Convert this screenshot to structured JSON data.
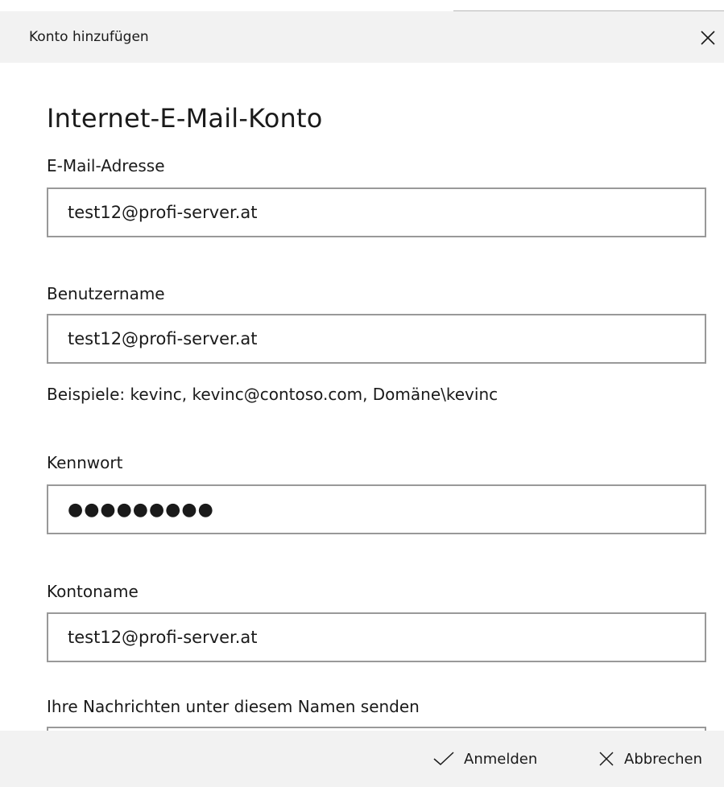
{
  "window": {
    "title": "Konto hinzufügen"
  },
  "form": {
    "heading": "Internet-E-Mail-Konto",
    "email": {
      "label": "E-Mail-Adresse",
      "value": "test12@profi-server.at"
    },
    "username": {
      "label": "Benutzername",
      "value": "test12@profi-server.at",
      "hint": "Beispiele: kevinc, kevinc@contoso.com, Domäne\\kevinc"
    },
    "password": {
      "label": "Kennwort",
      "masked_value": "●●●●●●●●●"
    },
    "account_name": {
      "label": "Kontoname",
      "value": "test12@profi-server.at"
    },
    "send_name": {
      "label": "Ihre Nachrichten unter diesem Namen senden",
      "value": ""
    }
  },
  "footer": {
    "signin_label": "Anmelden",
    "cancel_label": "Abbrechen"
  },
  "icons": {
    "close": "close-icon",
    "signin": "checkmark-icon",
    "cancel": "close-icon"
  }
}
